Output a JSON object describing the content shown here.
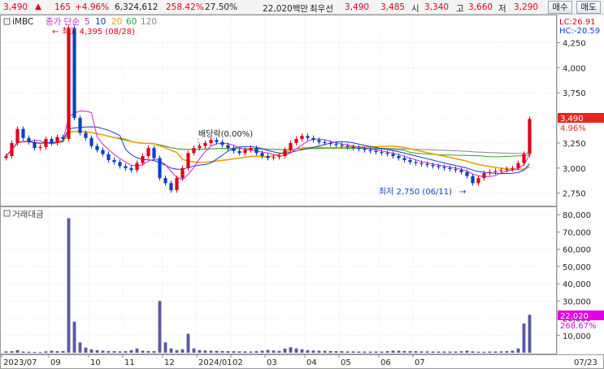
{
  "header": {
    "price": "3,490",
    "up_arrow": "▲",
    "change": "165",
    "change_pct": "+4.96%",
    "volume": "6,324,612",
    "volume_ratio": "258.42%",
    "turnover": "27.50%",
    "amount": "22,020백만",
    "best_ask_label": "최우선",
    "best_ask": "3,490",
    "best_bid": "3,485",
    "open_label": "시",
    "open": "3,340",
    "high_label": "고",
    "high": "3,660",
    "low_label": "저",
    "low": "3,290",
    "sell_button": "매수",
    "buy_button": "매도"
  },
  "price_panel": {
    "ticker": "iMBC",
    "ma_label": "종가 단순",
    "ma_periods": [
      "5",
      "10",
      "20",
      "60",
      "120"
    ],
    "lc_label": "LC:26.91",
    "hc_label": "HC:-20.59",
    "max_annotation": "최고 4,395 (08/28)",
    "min_annotation": "최저 2,750 (06/11)",
    "dividend_annotation": "배당락(0.00%)",
    "current_price_tag": "3,490",
    "current_pct_tag": "4.96%",
    "y_ticks": [
      "4,250",
      "4,000",
      "3,750",
      "3,500",
      "3,250",
      "3,000",
      "2,750"
    ]
  },
  "volume_panel": {
    "title": "거래대금",
    "current_tag": "22,020",
    "current_pct_tag": "268.67%",
    "y_ticks": [
      "80,000",
      "70,000",
      "60,000",
      "50,000",
      "40,000",
      "30,000",
      "20,000",
      "10,000"
    ]
  },
  "x_axis": {
    "labels": [
      "2023/07",
      "09",
      "10",
      "11",
      "12",
      "2024/01",
      "02",
      "03",
      "04",
      "05",
      "06",
      "07"
    ],
    "last_date": "07/23"
  },
  "colors": {
    "up": "#e0001b",
    "down": "#0a3fc7",
    "ma5": "#d01fd0",
    "ma10": "#0a3fc7",
    "ma20": "#f0a000",
    "ma60": "#2aa82a",
    "ma120": "#888888",
    "volume_bar": "#5a5aa0",
    "accent_tag": "#e8261d",
    "volume_tag": "#e500e5"
  },
  "chart_data": [
    {
      "type": "candlestick",
      "title": "iMBC",
      "xlabel": "",
      "ylabel": "",
      "ylim": [
        2650,
        4400
      ],
      "series": [
        {
          "name": "종가",
          "values": [
            3120,
            3250,
            3390,
            3300,
            3260,
            3200,
            3210,
            3290,
            3250,
            3310,
            3290,
            4395,
            3500,
            3350,
            3300,
            3220,
            3180,
            3140,
            3080,
            3060,
            3020,
            3000,
            2980,
            3050,
            3120,
            3200,
            3100,
            2900,
            2850,
            2780,
            2900,
            3000,
            3150,
            3200,
            3220,
            3250,
            3280,
            3260,
            3230,
            3200,
            3170,
            3150,
            3180,
            3200,
            3150,
            3120,
            3100,
            3110,
            3120,
            3180,
            3250,
            3290,
            3320,
            3300,
            3280,
            3260,
            3250,
            3240,
            3230,
            3220,
            3210,
            3200,
            3190,
            3180,
            3170,
            3160,
            3150,
            3140,
            3120,
            3100,
            3080,
            3060,
            3050,
            3040,
            3030,
            3020,
            3010,
            3000,
            2990,
            2980,
            2960,
            2920,
            2850,
            2900,
            2950,
            2960,
            2970,
            2980,
            2990,
            3000,
            3050,
            3140,
            3490
          ]
        }
      ]
    },
    {
      "type": "bar",
      "title": "거래대금",
      "xlabel": "",
      "ylabel": "",
      "ylim": [
        0,
        82000
      ],
      "series": [
        {
          "name": "거래대금",
          "values": [
            800,
            900,
            1500,
            700,
            600,
            500,
            400,
            800,
            1200,
            900,
            1000,
            78000,
            18000,
            6000,
            3000,
            2000,
            1500,
            1200,
            1000,
            900,
            800,
            900,
            1500,
            2500,
            1200,
            1000,
            900,
            30000,
            6000,
            2500,
            1500,
            2000,
            11000,
            2500,
            1500,
            1300,
            1200,
            1100,
            1000,
            900,
            900,
            800,
            800,
            700,
            900,
            1200,
            1600,
            1300,
            1100,
            2400,
            3200,
            2500,
            2000,
            1500,
            1300,
            1200,
            1100,
            1000,
            900,
            900,
            800,
            800,
            700,
            700,
            700,
            700,
            700,
            900,
            1200,
            1200,
            1000,
            900,
            900,
            800,
            800,
            700,
            700,
            700,
            700,
            700,
            900,
            1200,
            800,
            600,
            600,
            700,
            700,
            800,
            900,
            1200,
            2500,
            17000,
            22020
          ]
        }
      ]
    }
  ]
}
